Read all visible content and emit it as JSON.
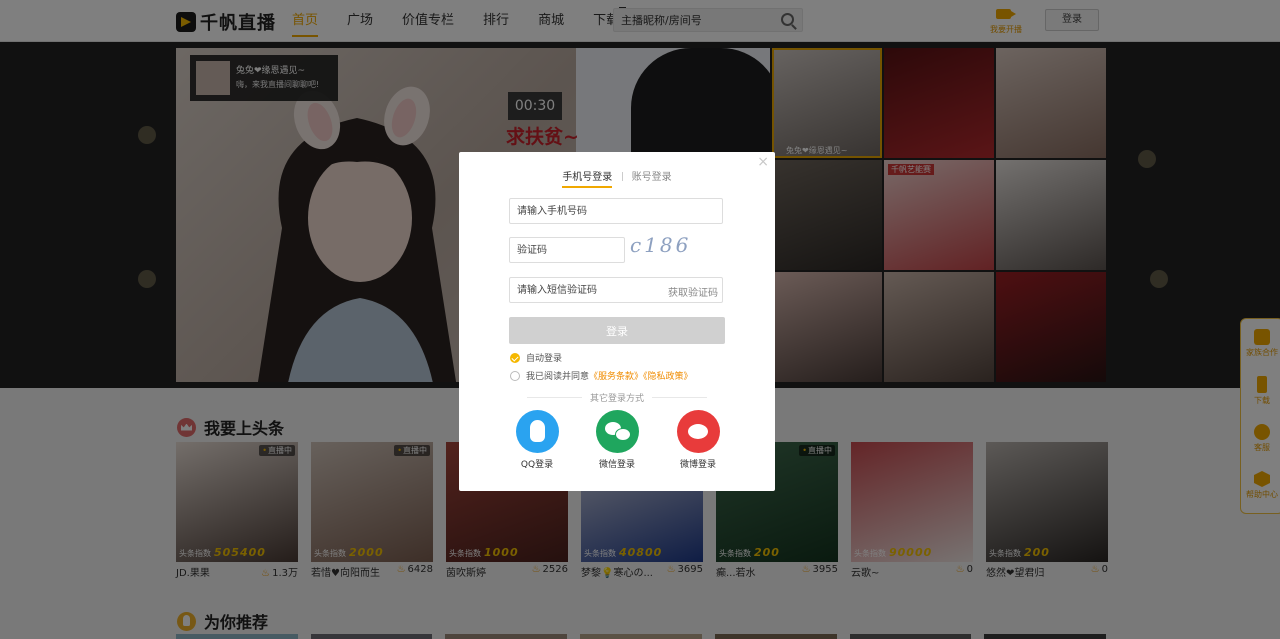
{
  "header": {
    "logo_text": "千帆直播",
    "nav": [
      {
        "label": "首页",
        "active": true
      },
      {
        "label": "广场",
        "active": false
      },
      {
        "label": "价值专栏",
        "active": false
      },
      {
        "label": "排行",
        "active": false
      },
      {
        "label": "商城",
        "active": false
      },
      {
        "label": "下载",
        "active": false,
        "badge": true
      }
    ],
    "search_placeholder": "主播昵称/房间号",
    "go_live_label": "我要开播",
    "login_label": "登录"
  },
  "player": {
    "anchor_name": "兔兔❤缘恩遇见~",
    "anchor_desc": "嗨，来我直播间聊聊吧!",
    "timer": "00:30",
    "promo_text": "求扶贫~"
  },
  "grid": {
    "selected_label": "兔兔❤缘恩遇见~",
    "tag_label": "千帆艺能赛"
  },
  "headline": {
    "title": "我要上头条",
    "live_tag": "直播中",
    "heat_label": "头条指数",
    "cards": [
      {
        "name": "JD.果果",
        "count": "1.3万",
        "heat": "505400",
        "live": true
      },
      {
        "name": "若惜♥向阳而生",
        "count": "6428",
        "heat": "2000",
        "live": true
      },
      {
        "name": "茵吹斯婷",
        "count": "2526",
        "heat": "1000",
        "live": false
      },
      {
        "name": "梦黎💡寒心の...",
        "count": "3695",
        "heat": "40800",
        "live": false
      },
      {
        "name": "癫...若水",
        "count": "3955",
        "heat": "200",
        "live": true
      },
      {
        "name": "云歌~",
        "count": "0",
        "heat": "90000",
        "live": false
      },
      {
        "name": "悠然❤望君归",
        "count": "0",
        "heat": "200",
        "live": false
      }
    ]
  },
  "recommend": {
    "title": "为你推荐"
  },
  "login_modal": {
    "tab_phone": "手机号登录",
    "tab_account": "账号登录",
    "phone_placeholder": "请输入手机号码",
    "captcha_placeholder": "验证码",
    "captcha_text": "c186",
    "sms_placeholder": "请输入短信验证码",
    "sms_button": "获取验证码",
    "submit_label": "登录",
    "auto_login_label": "自动登录",
    "agree_prefix": "我已阅读并同意",
    "terms_label": "《服务条款》",
    "privacy_label": "《隐私政策》",
    "other_title": "其它登录方式",
    "qq_label": "QQ登录",
    "wechat_label": "微信登录",
    "weibo_label": "微博登录",
    "close_icon": "×"
  },
  "side_panel": [
    {
      "label": "家族合作",
      "icon": "group-icon"
    },
    {
      "label": "下载",
      "icon": "phone-icon"
    },
    {
      "label": "客服",
      "icon": "chat-icon"
    },
    {
      "label": "帮助中心",
      "icon": "help-icon"
    }
  ]
}
